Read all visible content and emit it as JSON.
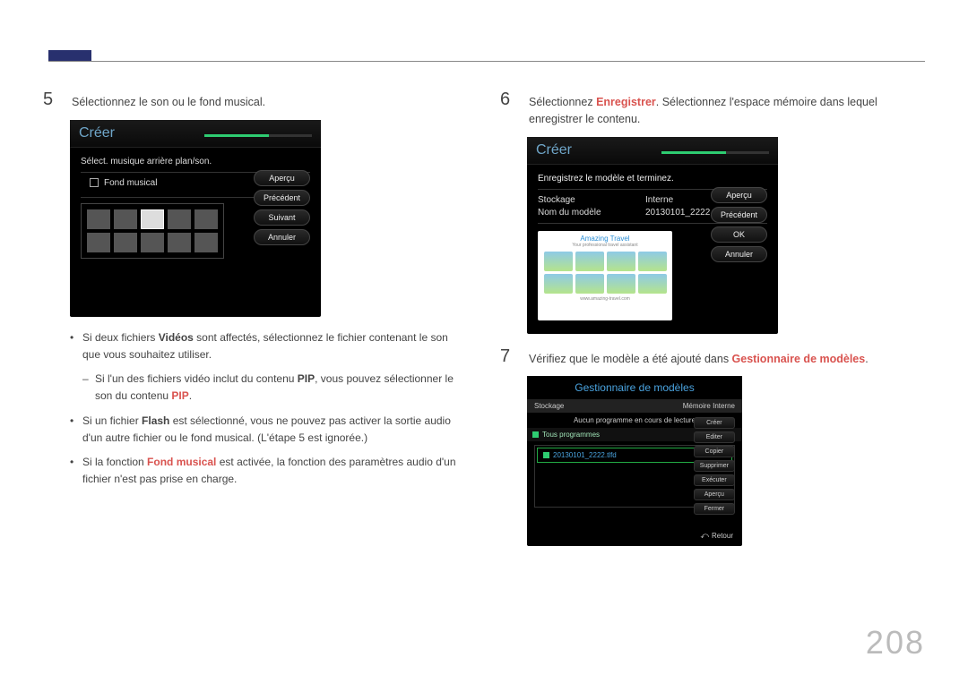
{
  "page_number": "208",
  "left": {
    "step5": {
      "num": "5",
      "text": "Sélectionnez le son ou le fond musical."
    },
    "device": {
      "title": "Créer",
      "prompt": "Sélect. musique arrière plan/son.",
      "checkbox_label": "Fond musical",
      "buttons": {
        "preview": "Aperçu",
        "prev": "Précédent",
        "next": "Suivant",
        "cancel": "Annuler"
      }
    },
    "bullets": {
      "b1_pre": "Si deux fichiers ",
      "b1_bold": "Vidéos",
      "b1_post": " sont affectés, sélectionnez le fichier contenant le son que vous souhaitez utiliser.",
      "b1s_pre": "Si l'un des fichiers vidéo inclut du contenu ",
      "b1s_bold": "PIP",
      "b1s_mid": ", vous pouvez sélectionner le son du contenu ",
      "b1s_bold2": "PIP",
      "b1s_post": ".",
      "b2_pre": "Si un fichier ",
      "b2_bold": "Flash",
      "b2_post": " est sélectionné, vous ne pouvez pas activer la sortie audio d'un autre fichier ou le fond musical. (L'étape 5 est ignorée.)",
      "b3_pre": "Si la fonction ",
      "b3_bold": "Fond musical",
      "b3_post": " est activée, la fonction des paramètres audio d'un fichier n'est pas prise en charge."
    }
  },
  "right": {
    "step6": {
      "num": "6",
      "pre": "Sélectionnez ",
      "bold": "Enregistrer",
      "post": ". Sélectionnez l'espace mémoire dans lequel enregistrer le contenu."
    },
    "device": {
      "title": "Créer",
      "prompt": "Enregistrez le modèle et terminez.",
      "storage_k": "Stockage",
      "storage_v": "Interne",
      "name_k": "Nom du modèle",
      "name_v": "20130101_2222",
      "buttons": {
        "preview": "Aperçu",
        "prev": "Précédent",
        "ok": "OK",
        "cancel": "Annuler"
      },
      "card": {
        "hdr": "Amazing Travel",
        "sub": "Your professional travel assistant",
        "ftr": "www.amazing-travel.com"
      }
    },
    "step7": {
      "num": "7",
      "pre": "Vérifiez que le modèle a été ajouté dans ",
      "bold": "Gestionnaire de modèles",
      "post": "."
    },
    "manager": {
      "title": "Gestionnaire de modèles",
      "storage_k": "Stockage",
      "storage_v": "Mémoire Interne",
      "msg": "Aucun programme en cours de lecture",
      "tab": "Tous programmes",
      "file": "20130101_2222.tlfd",
      "buttons": {
        "create": "Créer",
        "edit": "Editer",
        "copy": "Copier",
        "delete": "Supprimer",
        "run": "Exécuter",
        "preview": "Aperçu",
        "close": "Fermer"
      },
      "return": "Retour"
    }
  }
}
